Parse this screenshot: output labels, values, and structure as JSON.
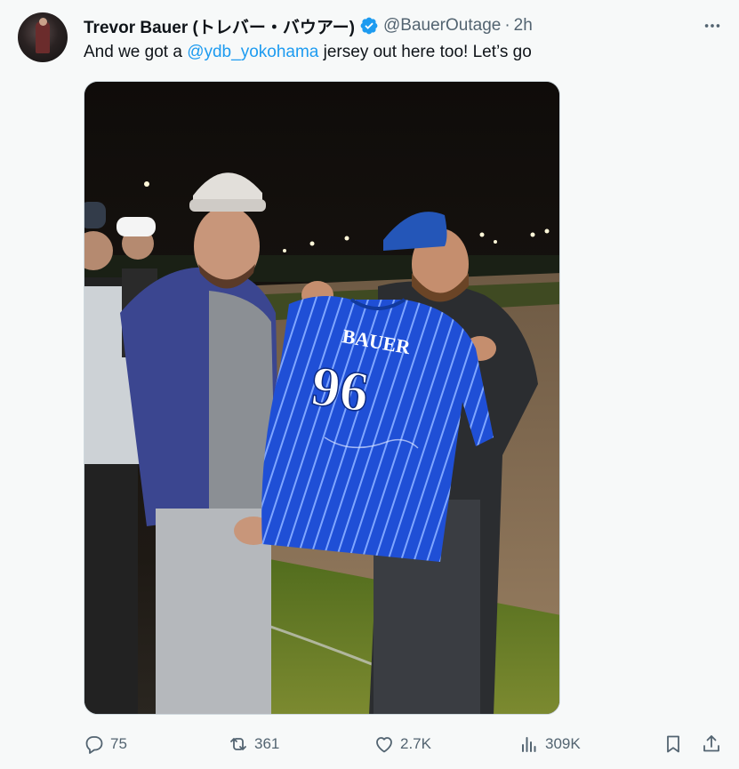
{
  "tweet": {
    "author_name": "Trevor Bauer (トレバー・バウアー)",
    "handle": "@BauerOutage",
    "separator": "·",
    "time": "2h",
    "text_before": "And we got a ",
    "mention": "@ydb_yokohama",
    "text_after": " jersey out here too! Let’s go"
  },
  "jersey": {
    "name": "BAUER",
    "number": "96"
  },
  "actions": {
    "replies": "75",
    "reposts": "361",
    "likes": "2.7K",
    "views": "309K"
  },
  "colors": {
    "accent": "#1d9bf0",
    "text_secondary": "#536471",
    "jersey_blue": "#1f4fd6"
  },
  "icons": {
    "more": "more-icon",
    "verified": "verified-badge-icon",
    "reply": "reply-icon",
    "repost": "repost-icon",
    "like": "heart-icon",
    "views": "views-chart-icon",
    "bookmark": "bookmark-icon",
    "share": "share-icon"
  }
}
